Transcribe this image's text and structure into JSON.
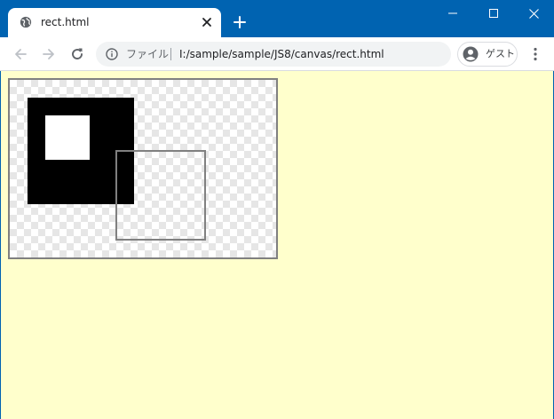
{
  "window": {
    "chrome_color": "#0063b1"
  },
  "tab": {
    "title": "rect.html",
    "favicon": "globe-icon"
  },
  "toolbar": {
    "back_icon": "arrow-left-icon",
    "forward_icon": "arrow-right-icon",
    "reload_icon": "reload-icon",
    "scheme_label": "ファイル",
    "url": "I:/sample/sample/JS8/canvas/rect.html",
    "profile_label": "ゲスト",
    "menu_icon": "kebab-menu-icon"
  },
  "page": {
    "background": "#ffffcc",
    "canvas": {
      "border_color": "#808080",
      "fill_color": "#000000",
      "stroke_color": "#808080"
    }
  }
}
